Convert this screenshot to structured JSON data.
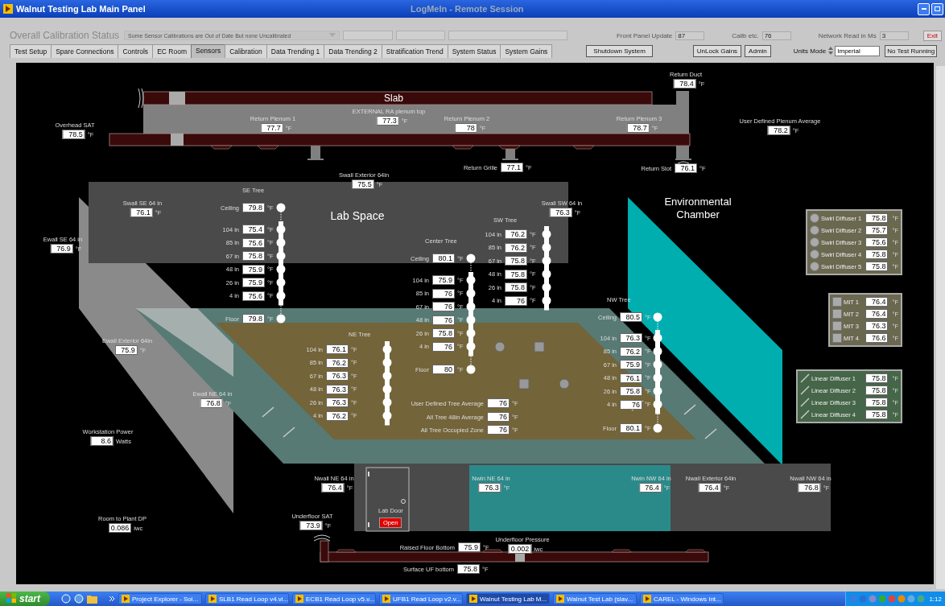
{
  "window": {
    "title": "Walnut Testing Lab Main Panel",
    "remote_session": "LogMeIn - Remote Session"
  },
  "header": {
    "calibration_label": "Overall Calibration Status",
    "calibration_status": "Some Sensor Calibrations are Out of Date But none Uncalibrated",
    "indicators": [
      {
        "label": "Front Panel Update",
        "value": "87"
      },
      {
        "label": "Calib etc.",
        "value": "76"
      },
      {
        "label": "Network Read in Ms",
        "value": "3"
      }
    ],
    "exit": "Exit"
  },
  "tabs": [
    {
      "label": "Test Setup",
      "selected": false
    },
    {
      "label": "Spare Connections",
      "selected": false
    },
    {
      "label": "Controls",
      "selected": false
    },
    {
      "label": "EC Room",
      "selected": false
    },
    {
      "label": "Sensors",
      "selected": true
    },
    {
      "label": "Calibration",
      "selected": false
    },
    {
      "label": "Data Trending 1",
      "selected": false
    },
    {
      "label": "Data Trending 2",
      "selected": false
    },
    {
      "label": "Stratification Trend",
      "selected": false
    },
    {
      "label": "System Status",
      "selected": false
    },
    {
      "label": "System Gains",
      "selected": false
    }
  ],
  "toolbar": {
    "shutdown": "Shutdown System",
    "unlock": "UnLock Gains",
    "admin": "Admin",
    "units_mode": {
      "label": "Units Mode",
      "value": "Imperial"
    },
    "test_status": "No Test Running"
  },
  "diagram": {
    "zones": [
      "Slab",
      "Lab Space",
      "Environmental Chamber"
    ],
    "readouts": [
      {
        "kind": "stacked",
        "label": "Overhead SAT",
        "value": "78.5",
        "unit": "°F"
      },
      {
        "kind": "stacked",
        "label": "Return Plenum 1",
        "value": "77.7",
        "unit": "°F"
      },
      {
        "kind": "stacked",
        "label": "EXTERNAL RA plenum top",
        "value": "77.3",
        "unit": "°F"
      },
      {
        "kind": "stacked",
        "label": "Return Plenum 2",
        "value": "78",
        "unit": "°F"
      },
      {
        "kind": "stacked",
        "label": "Return Plenum 3",
        "value": "78.7",
        "unit": "°F"
      },
      {
        "kind": "stacked",
        "label": "Return Duct",
        "value": "78.4",
        "unit": "°F"
      },
      {
        "kind": "stacked",
        "label": "User Defined Plenum Average",
        "value": "78.2",
        "unit": "°F"
      },
      {
        "kind": "inline",
        "label": "Return Grille",
        "value": "77.1",
        "unit": "°F"
      },
      {
        "kind": "inline",
        "label": "Return Slot",
        "value": "76.1",
        "unit": "°F"
      },
      {
        "kind": "stacked",
        "label": "Swall Exterior 64in",
        "value": "75.5",
        "unit": "°F"
      },
      {
        "kind": "stacked",
        "label": "Swall SE 64 in",
        "value": "76.1",
        "unit": "°F"
      },
      {
        "kind": "stacked",
        "label": "Ewall SE 64 in",
        "value": "76.9",
        "unit": "°F"
      },
      {
        "kind": "stacked",
        "label": "Swall SW 64 in",
        "value": "76.3",
        "unit": "°F"
      },
      {
        "kind": "stacked",
        "label": "Ewall Exterior 64in",
        "value": "75.9",
        "unit": "°F"
      },
      {
        "kind": "stacked",
        "label": "Ewall NE 64 in",
        "value": "76.8",
        "unit": "°F"
      },
      {
        "kind": "stacked",
        "label": "Workstation Power",
        "value": "8.6",
        "unit": "Watts"
      },
      {
        "kind": "inline",
        "label": "User Defined Tree Average",
        "value": "76",
        "unit": "°F"
      },
      {
        "kind": "inline",
        "label": "All Tree 48in Average",
        "value": "76",
        "unit": "°F"
      },
      {
        "kind": "inline",
        "label": "All Tree Occupied Zone",
        "value": "76",
        "unit": "°F"
      },
      {
        "kind": "stacked",
        "label": "Nwall NE 64 in",
        "value": "76.4",
        "unit": "°F"
      },
      {
        "kind": "stacked",
        "label": "Nwin NE 64 in",
        "value": "76.3",
        "unit": "°F"
      },
      {
        "kind": "stacked",
        "label": "Nwin NW 64 in",
        "value": "76.4",
        "unit": "°F"
      },
      {
        "kind": "stacked",
        "label": "Nwall Exterior 64in",
        "value": "76.4",
        "unit": "°F"
      },
      {
        "kind": "stacked",
        "label": "Nwall NW 64 in",
        "value": "76.8",
        "unit": "°F"
      },
      {
        "kind": "stacked",
        "label": "Room to Plant DP",
        "value": "0.086",
        "unit": "iwc"
      },
      {
        "kind": "stacked",
        "label": "Underfloor SAT",
        "value": "73.9",
        "unit": "°F"
      },
      {
        "kind": "inline",
        "label": "Raised Floor Bottom",
        "value": "75.9",
        "unit": "°F"
      },
      {
        "kind": "stacked",
        "label": "Underfloor Pressure",
        "value": "0.002",
        "unit": "iwc"
      },
      {
        "kind": "inline",
        "label": "Surface UF bottom",
        "value": "75.8",
        "unit": "°F"
      }
    ],
    "trees": [
      {
        "name": "SE Tree",
        "ceiling": {
          "label": "Ceiling",
          "value": "79.8",
          "unit": "°F"
        },
        "levels": [
          {
            "label": "104 in",
            "value": "75.4",
            "unit": "°F"
          },
          {
            "label": "85 in",
            "value": "75.6",
            "unit": "°F"
          },
          {
            "label": "67 in",
            "value": "75.8",
            "unit": "°F"
          },
          {
            "label": "48 in",
            "value": "75.9",
            "unit": "°F"
          },
          {
            "label": "26 in",
            "value": "75.9",
            "unit": "°F"
          },
          {
            "label": "4 in",
            "value": "75.6",
            "unit": "°F"
          }
        ],
        "floor": {
          "label": "Floor",
          "value": "79.8",
          "unit": "°F"
        }
      },
      {
        "name": "Center Tree",
        "ceiling": {
          "label": "Ceiling",
          "value": "80.1",
          "unit": "°F"
        },
        "levels": [
          {
            "label": "104 in",
            "value": "75.9",
            "unit": "°F"
          },
          {
            "label": "85 in",
            "value": "76",
            "unit": "°F"
          },
          {
            "label": "67 in",
            "value": "76",
            "unit": "°F"
          },
          {
            "label": "48 in",
            "value": "76",
            "unit": "°F"
          },
          {
            "label": "26 in",
            "value": "75.8",
            "unit": "°F"
          },
          {
            "label": "4 in",
            "value": "76",
            "unit": "°F"
          }
        ],
        "floor": {
          "label": "Floor",
          "value": "80",
          "unit": "°F"
        }
      },
      {
        "name": "SW Tree",
        "levels": [
          {
            "label": "104 in",
            "value": "76.2",
            "unit": "°F"
          },
          {
            "label": "85 in",
            "value": "76.2",
            "unit": "°F"
          },
          {
            "label": "67 in",
            "value": "75.8",
            "unit": "°F"
          },
          {
            "label": "48 in",
            "value": "75.8",
            "unit": "°F"
          },
          {
            "label": "26 in",
            "value": "75.8",
            "unit": "°F"
          },
          {
            "label": "4 in",
            "value": "76",
            "unit": "°F"
          }
        ]
      },
      {
        "name": "NE Tree",
        "levels": [
          {
            "label": "104 in",
            "value": "76.1",
            "unit": "°F"
          },
          {
            "label": "85 in",
            "value": "76.2",
            "unit": "°F"
          },
          {
            "label": "67 in",
            "value": "76.3",
            "unit": "°F"
          },
          {
            "label": "48 in",
            "value": "76.3",
            "unit": "°F"
          },
          {
            "label": "26 in",
            "value": "76.3",
            "unit": "°F"
          },
          {
            "label": "4 in",
            "value": "76.2",
            "unit": "°F"
          }
        ]
      },
      {
        "name": "NW Tree",
        "ceiling": {
          "label": "Ceiling",
          "value": "80.5",
          "unit": "°F"
        },
        "levels": [
          {
            "label": "104 in",
            "value": "76.3",
            "unit": "°F"
          },
          {
            "label": "85 in",
            "value": "76.2",
            "unit": "°F"
          },
          {
            "label": "67 in",
            "value": "75.9",
            "unit": "°F"
          },
          {
            "label": "48 in",
            "value": "76.1",
            "unit": "°F"
          },
          {
            "label": "26 in",
            "value": "75.8",
            "unit": "°F"
          },
          {
            "label": "4 in",
            "value": "76",
            "unit": "°F"
          }
        ],
        "floor": {
          "label": "Floor",
          "value": "80.1",
          "unit": "°F"
        }
      }
    ],
    "panels": [
      {
        "kind": "swirl",
        "items": [
          {
            "label": "Swirl Diffuser 1",
            "value": "75.8",
            "unit": "°F"
          },
          {
            "label": "Swirl Diffuser 2",
            "value": "75.7",
            "unit": "°F"
          },
          {
            "label": "Swirl Diffuser 3",
            "value": "75.6",
            "unit": "°F"
          },
          {
            "label": "Swirl Diffuser 4",
            "value": "75.8",
            "unit": "°F"
          },
          {
            "label": "Swirl Diffuser 5",
            "value": "75.8",
            "unit": "°F"
          }
        ]
      },
      {
        "kind": "mit",
        "items": [
          {
            "label": "MIT 1",
            "value": "76.4",
            "unit": "°F"
          },
          {
            "label": "MIT 2",
            "value": "76.4",
            "unit": "°F"
          },
          {
            "label": "MIT 3",
            "value": "76.3",
            "unit": "°F"
          },
          {
            "label": "MIT 4",
            "value": "76.6",
            "unit": "°F"
          }
        ]
      },
      {
        "kind": "linear",
        "items": [
          {
            "label": "Linear Diffuser 1",
            "value": "75.8",
            "unit": "°F"
          },
          {
            "label": "Linear Diffuser 2",
            "value": "75.8",
            "unit": "°F"
          },
          {
            "label": "Linear Diffuser 3",
            "value": "75.8",
            "unit": "°F"
          },
          {
            "label": "Linear Diffuser 4",
            "value": "75.8",
            "unit": "°F"
          }
        ]
      }
    ],
    "lab_door": {
      "label": "Lab Door",
      "status": "Open",
      "open": true
    }
  },
  "taskbar": {
    "start": "start",
    "tasks": [
      {
        "label": "Project Explorer - Sol...",
        "selected": false
      },
      {
        "label": "SLB1 Read Loop v4.vi...",
        "selected": false
      },
      {
        "label": "ECB1 Read Loop v5.v...",
        "selected": false
      },
      {
        "label": "UFB1 Read Loop v2.v...",
        "selected": false
      },
      {
        "label": "Walnut Testing Lab M...",
        "selected": true
      },
      {
        "label": "Walnut Test Lab (slav...",
        "selected": false
      },
      {
        "label": "CAREL - Windows Int...",
        "selected": false
      }
    ],
    "clock": "1:12"
  }
}
